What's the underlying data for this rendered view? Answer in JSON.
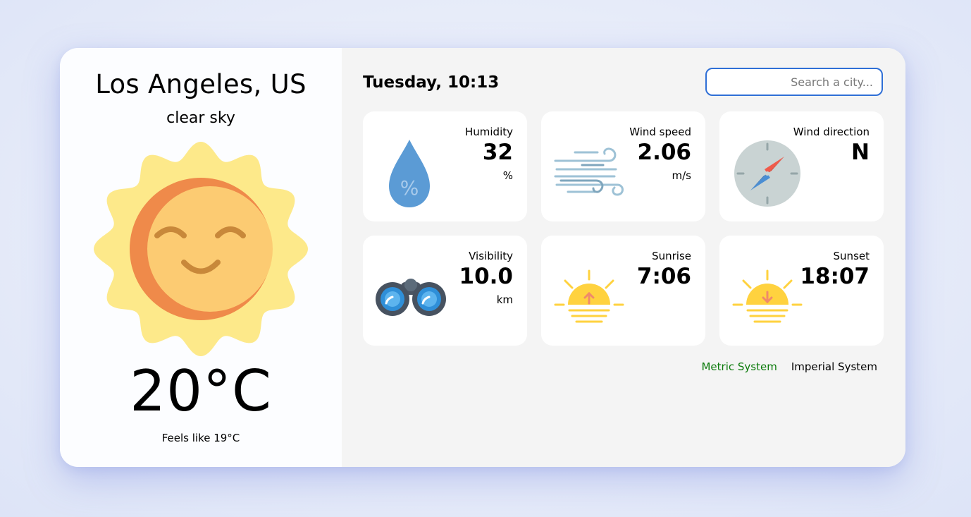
{
  "location": {
    "city": "Los Angeles, US",
    "description": "clear sky",
    "weather_icon": "sun-icon",
    "temperature": "20°C",
    "feels_like": "Feels like 19°C"
  },
  "header": {
    "datetime": "Tuesday, 10:13",
    "search_placeholder": "Search a city..."
  },
  "tiles": [
    {
      "label": "Humidity",
      "value": "32",
      "unit": "%",
      "icon": "water-drop-icon"
    },
    {
      "label": "Wind speed",
      "value": "2.06",
      "unit": "m/s",
      "icon": "wind-icon"
    },
    {
      "label": "Wind direction",
      "value": "N",
      "unit": "",
      "icon": "compass-icon"
    },
    {
      "label": "Visibility",
      "value": "10.0",
      "unit": "km",
      "icon": "binoculars-icon"
    },
    {
      "label": "Sunrise",
      "value": "7:06",
      "unit": "",
      "icon": "sunrise-icon"
    },
    {
      "label": "Sunset",
      "value": "18:07",
      "unit": "",
      "icon": "sunset-icon"
    }
  ],
  "unit_toggle": {
    "metric_label": "Metric System",
    "imperial_label": "Imperial System",
    "selected": "metric"
  },
  "colors": {
    "accent_green": "#0a7a0a",
    "search_border": "#2f6fd6",
    "sun_outer": "#fde98a",
    "sun_face": "#fccb72",
    "sun_shade": "#ef8a4a"
  }
}
